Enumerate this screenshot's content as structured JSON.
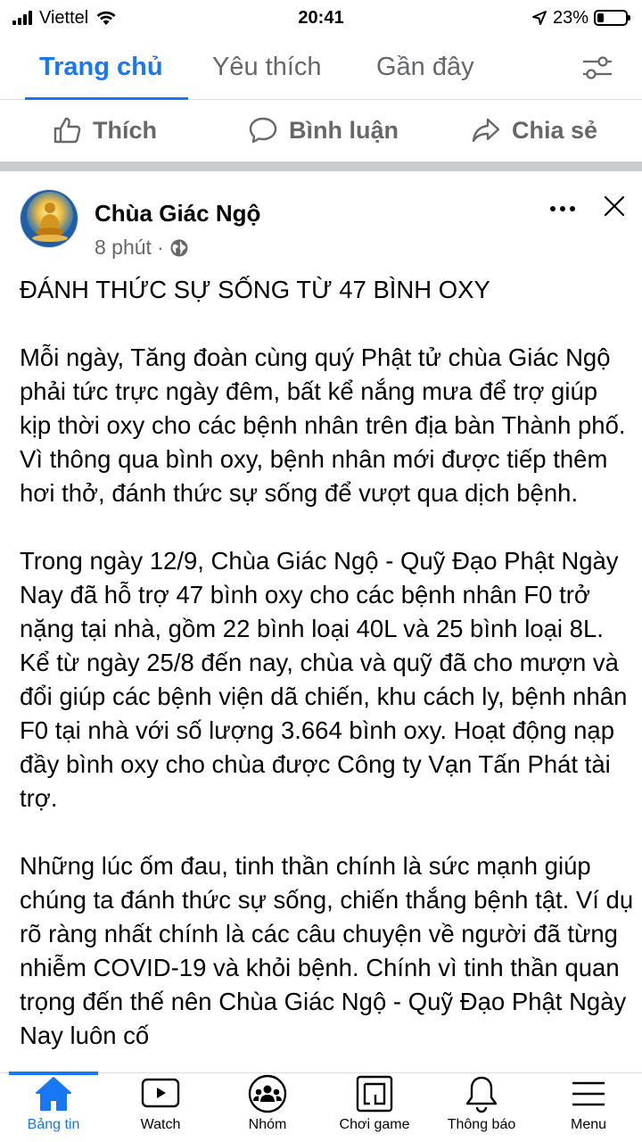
{
  "status": {
    "carrier": "Viettel",
    "time": "20:41",
    "battery": "23%",
    "battery_level": 0.23
  },
  "tabs": [
    {
      "label": "Trang chủ",
      "active": true
    },
    {
      "label": "Yêu thích",
      "active": false
    },
    {
      "label": "Gần đây",
      "active": false
    }
  ],
  "actions": {
    "like": "Thích",
    "comment": "Bình luận",
    "share": "Chia sẻ"
  },
  "post": {
    "page_name": "Chùa Giác Ngộ",
    "time": "8 phút",
    "privacy_icon": "globe-icon",
    "title": "ĐÁNH THỨC SỰ SỐNG TỪ 47 BÌNH OXY",
    "paragraphs": [
      "Mỗi ngày, Tăng đoàn cùng quý Phật tử chùa Giác Ngộ phải tức trực ngày đêm, bất kể nắng mưa để trợ giúp kịp thời oxy cho các bệnh nhân trên địa bàn Thành phố. Vì thông qua bình oxy, bệnh nhân mới được tiếp thêm hơi thở, đánh thức sự sống để vượt qua dịch bệnh.",
      "Trong ngày 12/9, Chùa Giác Ngộ - Quỹ Đạo Phật Ngày Nay đã hỗ trợ 47 bình oxy cho các bệnh nhân F0 trở nặng tại nhà, gồm 22 bình loại 40L và 25 bình loại 8L. Kể từ ngày 25/8 đến nay, chùa và quỹ đã cho mượn và đổi giúp các bệnh viện dã chiến, khu cách ly, bệnh nhân F0 tại nhà với số lượng 3.664 bình oxy. Hoạt động nạp đầy bình oxy cho chùa được Công ty Vạn Tấn Phát tài trợ.",
      "Những lúc ốm đau, tinh thần chính là sức mạnh giúp chúng ta đánh thức sự sống, chiến thắng bệnh tật. Ví dụ rõ ràng nhất chính là các câu chuyện về người đã từng nhiễm COVID-19 và khỏi bệnh. Chính vì tinh thần quan trọng đến thế nên Chùa Giác Ngộ - Quỹ Đạo Phật Ngày Nay luôn cố"
    ]
  },
  "bottom_nav": [
    {
      "label": "Bảng tin",
      "icon": "home-icon",
      "active": true
    },
    {
      "label": "Watch",
      "icon": "watch-icon",
      "active": false
    },
    {
      "label": "Nhóm",
      "icon": "groups-icon",
      "active": false
    },
    {
      "label": "Chơi game",
      "icon": "gaming-icon",
      "active": false
    },
    {
      "label": "Thông báo",
      "icon": "bell-icon",
      "active": false
    },
    {
      "label": "Menu",
      "icon": "menu-icon",
      "active": false
    }
  ],
  "colors": {
    "accent": "#1877f2",
    "secondary_text": "#65676b",
    "separator": "#c9ccd1"
  }
}
